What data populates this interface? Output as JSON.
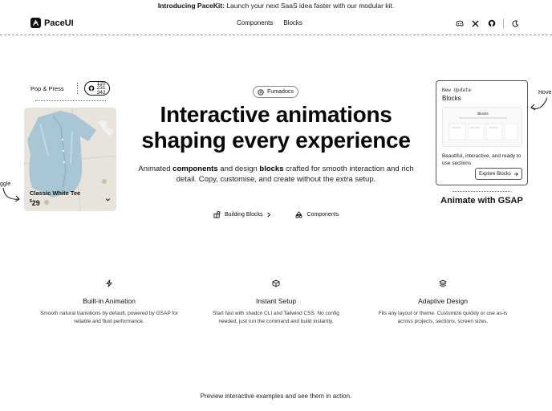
{
  "announcement": {
    "bold": "Introducing PaceKit:",
    "text": " Launch your next SaaS idea faster with our modular kit."
  },
  "nav": {
    "brand": "PaceUI",
    "links": [
      "Components",
      "Blocks"
    ],
    "icons": [
      "discord-icon",
      "x-icon",
      "github-icon",
      "theme-toggle-icon"
    ]
  },
  "left_card": {
    "press_label": "Pop & Press",
    "github_counts": [
      "120",
      "231",
      "342"
    ],
    "product_name": "Classic White Tee",
    "product_price_symbol": "$",
    "product_price": "29"
  },
  "toggle_hint": "ggle",
  "hero": {
    "badge": "Fumadocs",
    "headline_line1": "Interactive animations",
    "headline_line2": "shaping every experience",
    "sub_1": "Animated ",
    "sub_components": "components",
    "sub_2": " and design ",
    "sub_blocks": "blocks",
    "sub_3": " crafted for smooth interaction and rich detail. Copy, customise, and create without the extra setup.",
    "cta_primary": "Building Blocks",
    "cta_secondary": "Components"
  },
  "right_card": {
    "tag": "New Update",
    "title": "Blocks",
    "preview_title": "Blocks",
    "description": "Beautiful, interactive, and ready to use sections",
    "button": "Explore Blocks",
    "caption": "Animate with GSAP"
  },
  "hover_hint": "Hove",
  "features": [
    {
      "title": "Built-in Animation",
      "desc": "Smooth natural transitions by default, powered by GSAP for reliable and fluid performance.",
      "icon": "bolt-icon"
    },
    {
      "title": "Instant Setup",
      "desc": "Start fast with shadcn CLI and Tailwind CSS. No config needed, just run the command and build instantly.",
      "icon": "cube-icon"
    },
    {
      "title": "Adaptive Design",
      "desc": "Fits any layout or theme. Customize quickly or use as-is across projects, sections, screen sizes.",
      "icon": "layers-icon"
    }
  ],
  "bottom_text": "Preview interactive examples and see them in action.",
  "colors": {
    "text": "#111111",
    "border": "#555555",
    "background": "#ffffff"
  }
}
